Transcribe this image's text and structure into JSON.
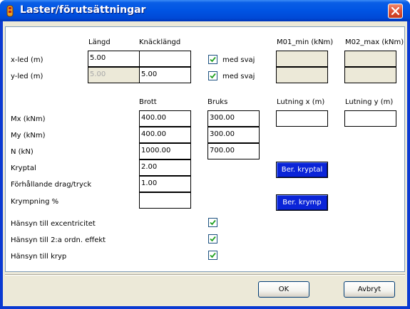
{
  "window": {
    "title": "Laster/förutsättningar",
    "colors": {
      "titlebar": "#0054e3",
      "client": "#ece9d8",
      "action_button": "#0a24d8",
      "close": "#e0553a"
    }
  },
  "span": {
    "col_length": "Längd",
    "col_buckling": "Knäcklängd",
    "row_x": "x-led (m)",
    "row_y": "y-led (m)",
    "x_length": "5.00",
    "x_buckling": "",
    "y_length": "5.00",
    "y_buckling": "5.00",
    "x_sway_label": "med svaj",
    "y_sway_label": "med svaj",
    "x_sway_checked": true,
    "y_sway_checked": true
  },
  "moments": {
    "m01_label": "M01_min (kNm)",
    "m02_label": "M02_max (kNm)",
    "m01_values": [
      "",
      ""
    ],
    "m02_values": [
      "",
      ""
    ]
  },
  "loads": {
    "col_ultimate": "Brott",
    "col_service": "Bruks",
    "rows": [
      {
        "label": "Mx (kNm)",
        "ultimate": "400.00",
        "service": "300.00"
      },
      {
        "label": "My (kNm)",
        "ultimate": "400.00",
        "service": "300.00"
      },
      {
        "label": "N  (kN)",
        "ultimate": "1000.00",
        "service": "700.00"
      },
      {
        "label": "Kryptal",
        "ultimate": "2.00"
      },
      {
        "label": "Förhållande drag/tryck",
        "ultimate": "1.00"
      },
      {
        "label": "Krympning %",
        "ultimate": ""
      }
    ]
  },
  "slope": {
    "x_label": "Lutning x (m)",
    "y_label": "Lutning y (m)",
    "x_value": "",
    "y_value": ""
  },
  "actions": {
    "calc_creep": "Ber. kryptal",
    "calc_shrink": "Ber. krymp"
  },
  "options": [
    {
      "label": "Hänsyn till excentricitet",
      "checked": true
    },
    {
      "label": "Hänsyn till 2:a ordn. effekt",
      "checked": true
    },
    {
      "label": "Hänsyn till kryp",
      "checked": true
    }
  ],
  "footer": {
    "ok": "OK",
    "cancel": "Avbryt"
  },
  "icons": {
    "title": "app-icon",
    "close": "close-icon",
    "check": "check-icon"
  }
}
